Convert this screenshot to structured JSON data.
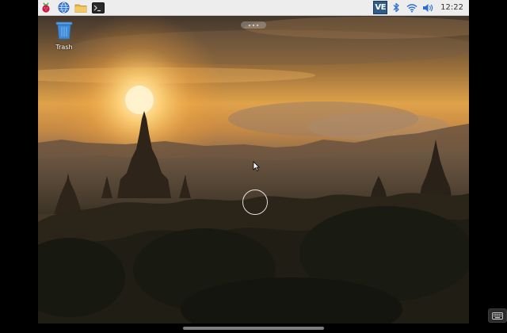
{
  "taskbar": {
    "launchers": [
      {
        "name": "raspberry-menu-icon"
      },
      {
        "name": "web-browser-icon"
      },
      {
        "name": "file-manager-icon"
      },
      {
        "name": "terminal-icon"
      }
    ],
    "tray": {
      "vnc_label": "VE",
      "clock": "12:22"
    }
  },
  "desktop": {
    "trash_label": "Trash"
  },
  "colors": {
    "taskbar_bg": "#ededed",
    "vnc_blue": "#2f5d8a",
    "bluetooth": "#2c6fce"
  }
}
